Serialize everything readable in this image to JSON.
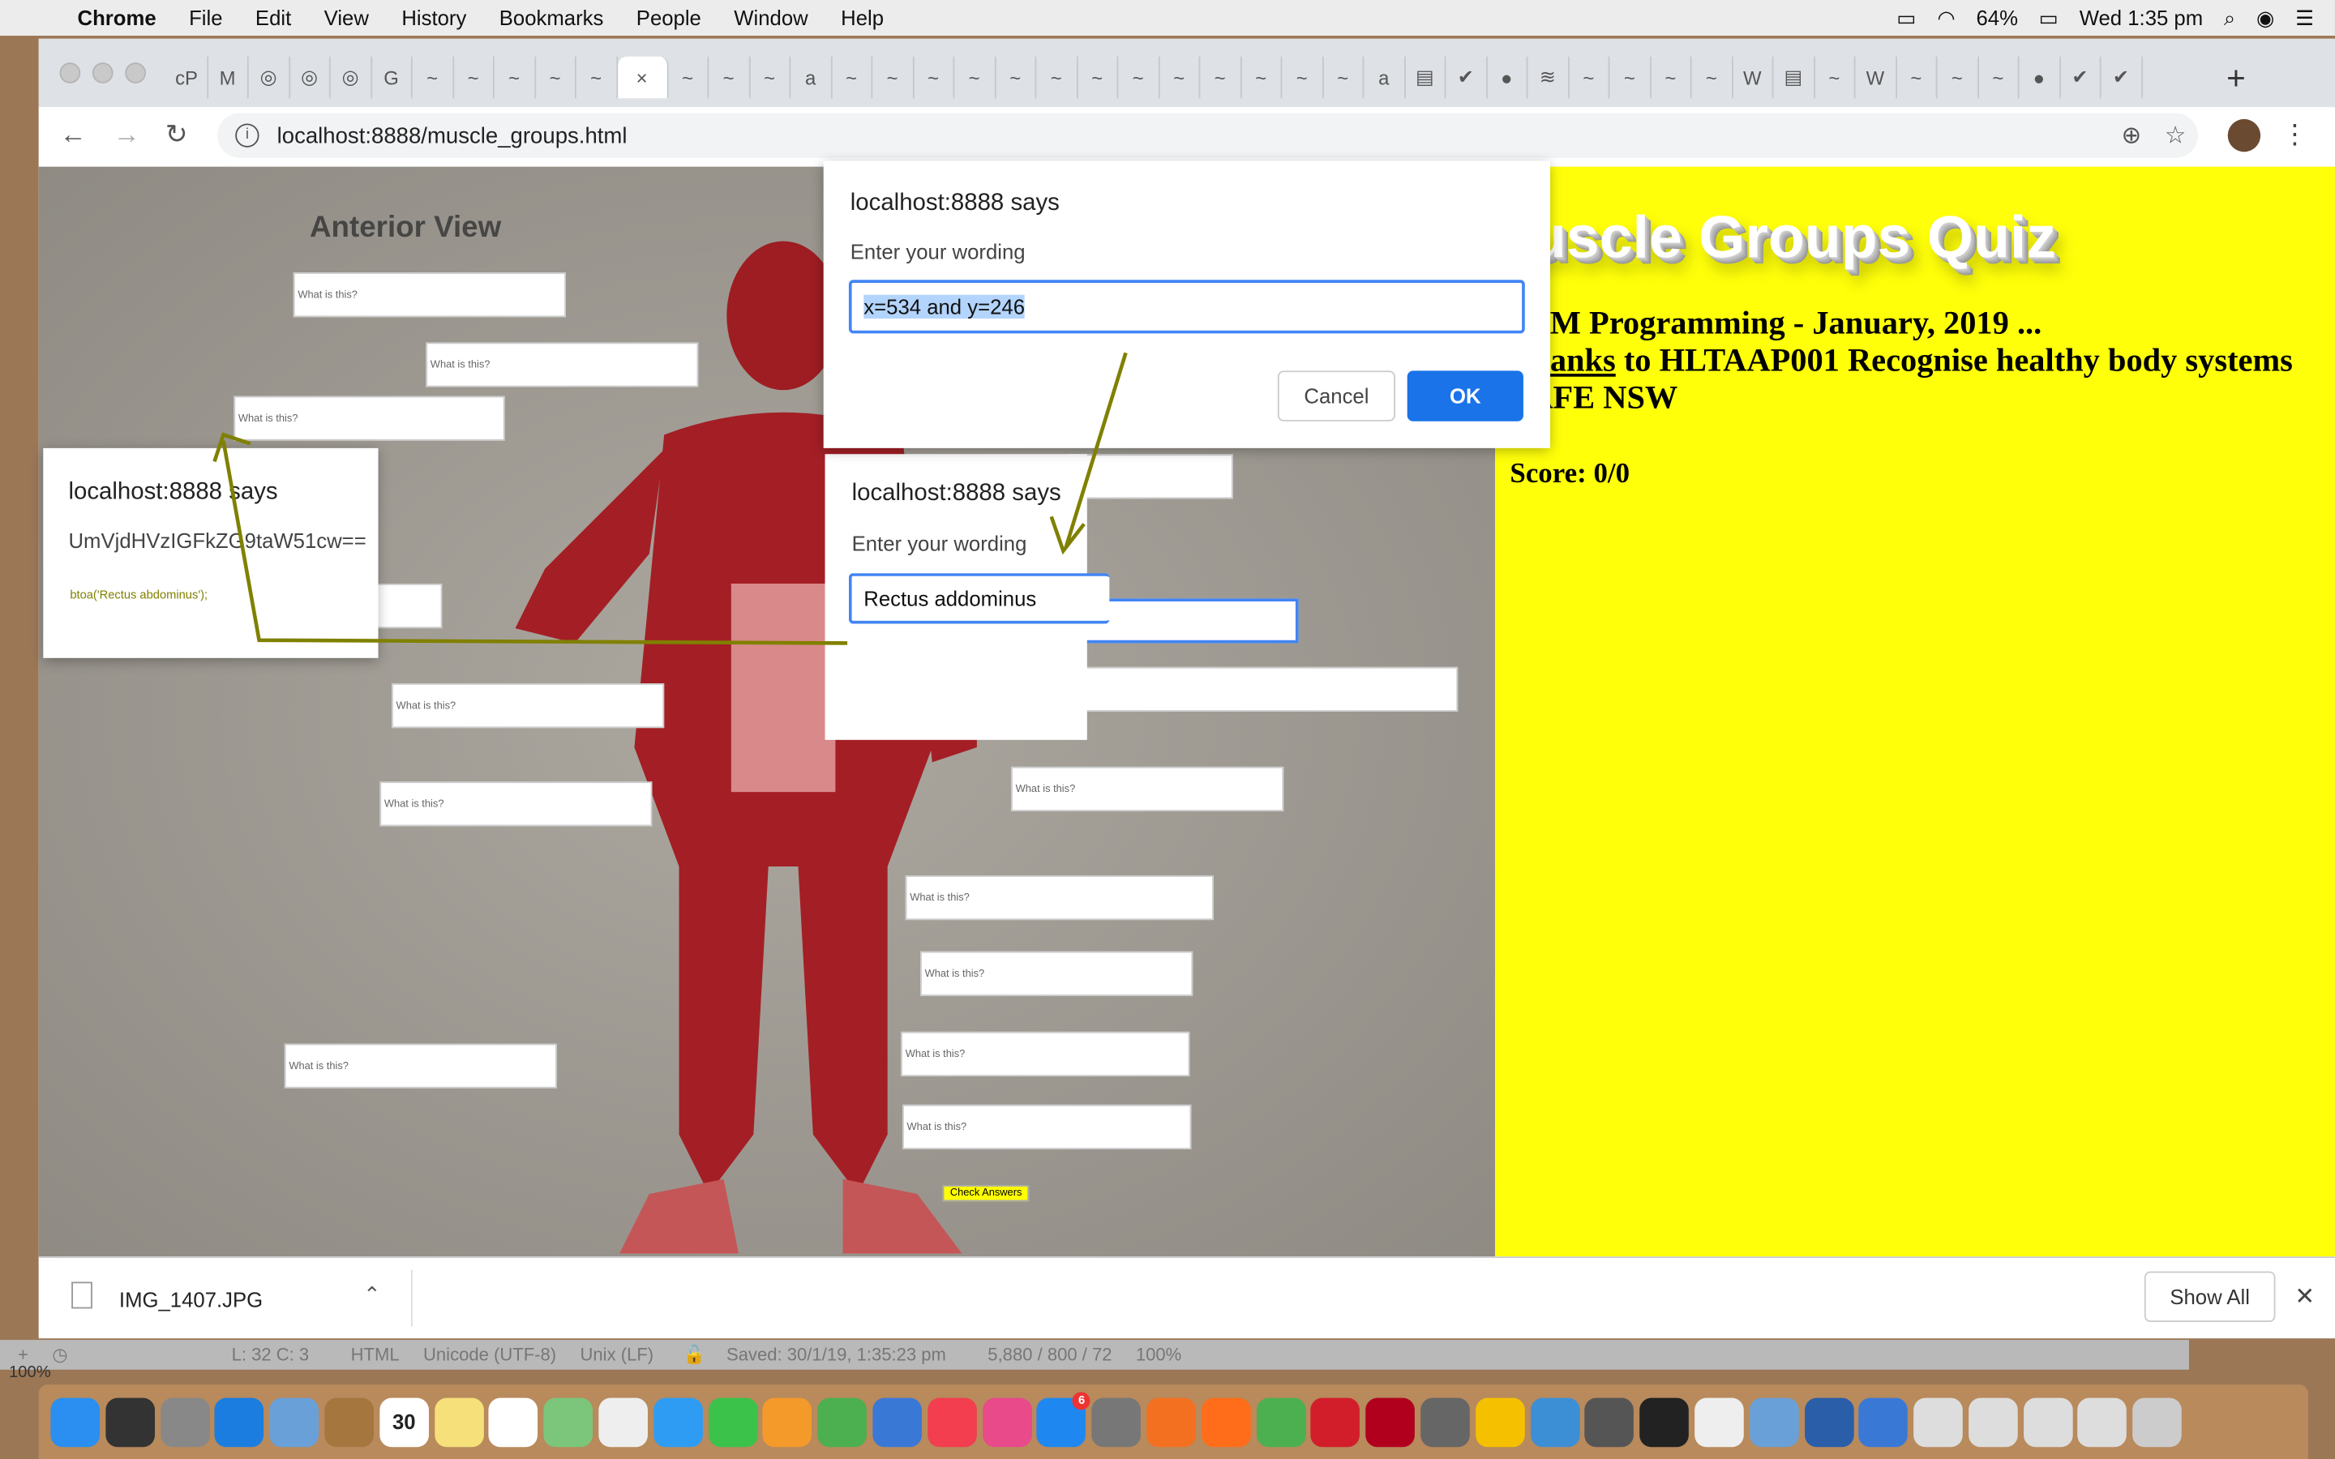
{
  "menubar": {
    "app": "Chrome",
    "items": [
      "File",
      "Edit",
      "View",
      "History",
      "Bookmarks",
      "People",
      "Window",
      "Help"
    ],
    "battery": "64%",
    "clock": "Wed 1:35 pm"
  },
  "tabs": [
    "cP",
    "M",
    "◎",
    "◎",
    "◎",
    "G",
    "~",
    "~",
    "~",
    "~",
    "~",
    "×",
    "~",
    "~",
    "~",
    "a",
    "~",
    "~",
    "~",
    "~",
    "~",
    "~",
    "~",
    "~",
    "~",
    "~",
    "~",
    "~",
    "~",
    "a",
    "▤",
    "✔",
    "●",
    "≋",
    "~",
    "~",
    "~",
    "~",
    "W",
    "▤",
    "~",
    "W",
    "~",
    "~",
    "~",
    "●",
    "✔",
    "✔"
  ],
  "toolbar": {
    "url": "localhost:8888/muscle_groups.html"
  },
  "page": {
    "anterior_view": "Anterior View",
    "label_placeholder": "What is this?",
    "check_answers": "Check Answers",
    "title": "Muscle Groups Quiz",
    "intro_line1": "RJM Programming - January, 2019 ...",
    "intro_thanks": "Thanks",
    "intro_line2_rest": " to HLTAAP001 Recognise healthy body systems",
    "intro_line3": "TAFE NSW",
    "score": "Score: 0/0"
  },
  "dialog_top": {
    "title": "localhost:8888 says",
    "message": "Enter your wording",
    "value": "x=534 and y=246",
    "cancel": "Cancel",
    "ok": "OK"
  },
  "dialog_mid": {
    "title": "localhost:8888 says",
    "message": "Enter your wording",
    "value": "Rectus addominus"
  },
  "dialog_left": {
    "title": "localhost:8888 says",
    "message": "UmVjdHVzIGFkZG9taW51cw==",
    "annotation": "btoa('Rectus abdominus');"
  },
  "downloads": {
    "file": "IMG_1407.JPG",
    "show_all": "Show All"
  },
  "statusbar": {
    "zoom_left": "100%",
    "position": "L: 32 C: 3",
    "syntax": "HTML",
    "encoding": "Unicode (UTF-8)",
    "line_endings": "Unix (LF)",
    "saved": "Saved: 30/1/19, 1:35:23 pm",
    "counts": "5,880 / 800 / 72",
    "zoom": "100%"
  },
  "dock": {
    "calendar_day": "30",
    "appstore_badge": "6",
    "apps": [
      "Finder",
      "Siri",
      "Launchpad",
      "Safari",
      "Mail",
      "Contacts",
      "Calendar",
      "Notes",
      "Reminders",
      "Maps",
      "Photos",
      "Messages",
      "FaceTime",
      "Pages",
      "Numbers",
      "Keynote",
      "News",
      "iTunes",
      "App Store",
      "System Preferences",
      "Avast",
      "Firefox",
      "Chrome",
      "Opera",
      "FileZilla",
      "Sequel",
      "Cyberduck",
      "Xcode",
      "GIMP",
      "Terminal",
      "TextEdit",
      "Preview",
      "QuickTime",
      "Downloads",
      "Docs",
      "Docs",
      "Docs",
      "Docs",
      "Trash"
    ]
  },
  "colors": {
    "page_bg": "#ffff0a",
    "annotation": "#808000",
    "ok_button": "#1a73e8"
  }
}
